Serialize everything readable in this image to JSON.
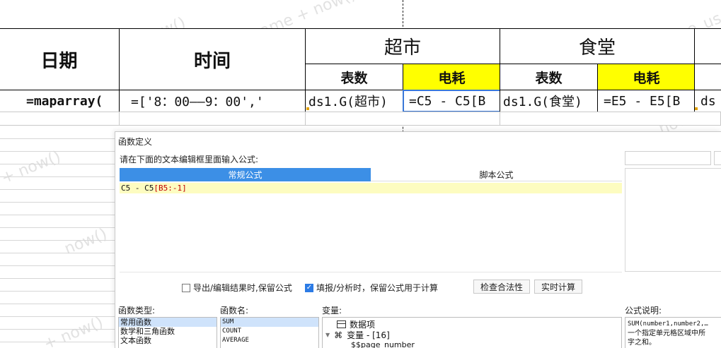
{
  "sheet": {
    "watermark_parts": [
      "$fine_username + now()",
      "$fine_username + now()",
      "+ now()",
      "now()",
      "$fine_us",
      "now()",
      "$fine_username + now()",
      "+ now()",
      "now()"
    ],
    "headers": {
      "date": "日期",
      "time": "时间",
      "market": "超市",
      "canteen": "食堂",
      "sub_meter_1": "表数",
      "sub_power_1": "电耗",
      "sub_meter_2": "表数",
      "sub_power_2": "电耗"
    },
    "row": {
      "date_formula": "=maparray(",
      "time_formula": "=['8：00——9：00','",
      "market_meter": "ds1.G(超市)",
      "market_power": "=C5 - C5[B",
      "canteen_meter": "ds1.G(食堂)",
      "canteen_power": "=E5 - E5[B",
      "last": "ds"
    }
  },
  "dialog": {
    "title": "函数定义",
    "prompt": "请在下面的文本编辑框里面输入公式:",
    "tabs": [
      "常规公式",
      "脚本公式"
    ],
    "formula": {
      "part1": "C5 - C5",
      "part2": "[B5:-1]"
    },
    "options": {
      "keep_on_export": "导出/编辑结果时,保留公式",
      "keep_on_fill": "填报/分析时，保留公式用于计算"
    },
    "option_states": {
      "keep_on_export": false,
      "keep_on_fill": true
    },
    "buttons": {
      "check": "检查合法性",
      "realtime": "实时计算"
    },
    "labels": {
      "func_type": "函数类型:",
      "func_name": "函数名:",
      "variable": "变量:",
      "description": "公式说明:"
    },
    "func_types": [
      "常用函数",
      "数学和三角函数",
      "文本函数"
    ],
    "func_names": [
      "SUM",
      "COUNT",
      "AVERAGE"
    ],
    "variables": {
      "data_items": "数据项",
      "variable_group": "变量 - [16]",
      "page_number": "$$page_number"
    },
    "desc": {
      "signature": "SUM(number1,number2,…",
      "line2": "一个指定单元格区域中所",
      "line3": "字之和。"
    }
  }
}
